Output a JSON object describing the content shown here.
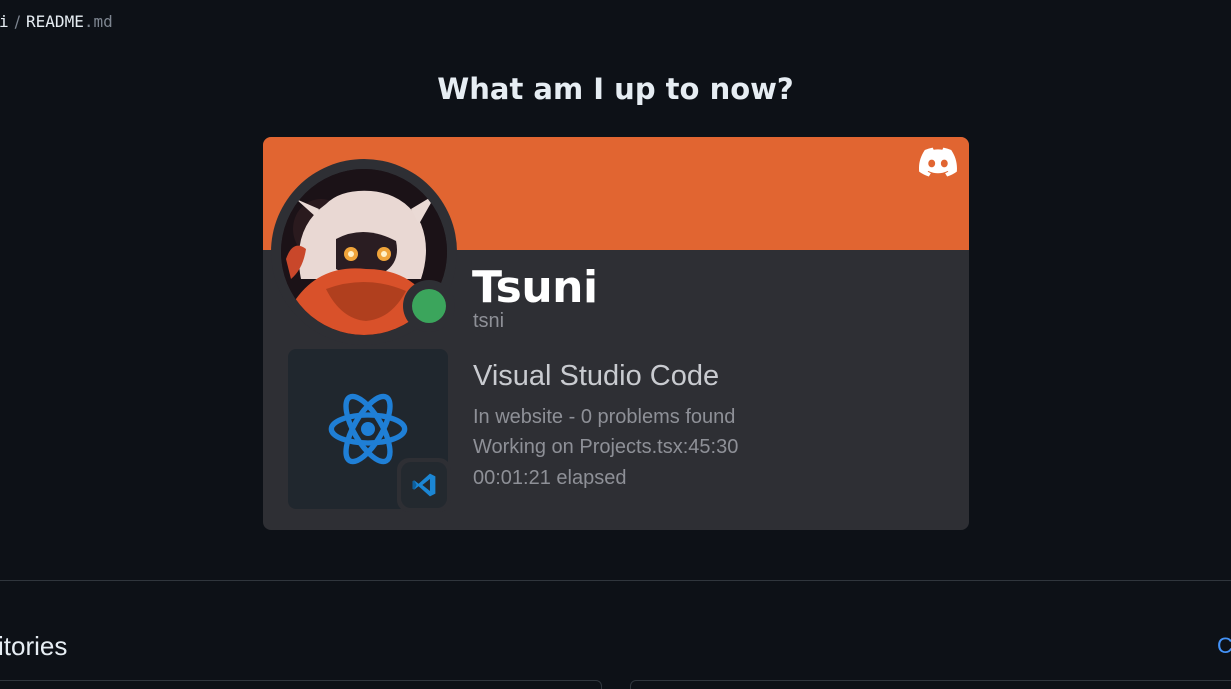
{
  "breadcrumb": {
    "parent": "i",
    "separator": "/",
    "file_name": "README",
    "file_ext": ".md"
  },
  "readme": {
    "heading": "What am I up to now?"
  },
  "discord_card": {
    "banner_color": "#e16531",
    "display_name": "Tsuni",
    "username": "tsni",
    "status": "online",
    "status_color": "#3ba55c",
    "activity": {
      "name": "Visual Studio Code",
      "details": "In website - 0 problems found",
      "state": "Working on Projects.tsx:45:30",
      "elapsed": "00:01:21 elapsed",
      "large_image": "react-icon",
      "small_image": "vscode-icon"
    }
  },
  "repositories": {
    "title_fragment": "itories",
    "link_fragment": "C"
  },
  "colors": {
    "background": "#0d1117",
    "card": "#2e2f34",
    "accent_link": "#4493f8"
  }
}
